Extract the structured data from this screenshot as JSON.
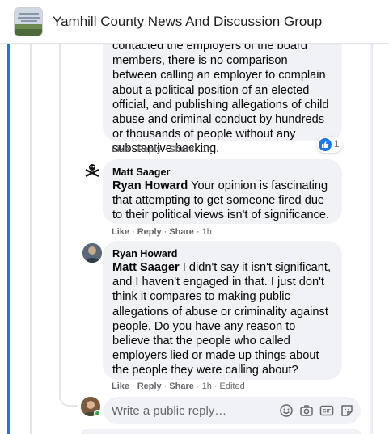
{
  "header": {
    "group_name": "Yamhill County News And Discussion Group"
  },
  "comments": [
    {
      "text": "contacted the employers of the board members, there is no comparison between calling an employer to complain about a political position of an elected official, and publishing allegations of child abuse and criminal conduct by hundreds or thousands of people without any substantive backing.",
      "actions": {
        "like": "Like",
        "reply": "Reply",
        "share": "Share",
        "time": "1h"
      },
      "reaction_count": "1",
      "reaction_icon": "like-icon"
    },
    {
      "author": "Matt Saager",
      "mention": "Ryan Howard",
      "text": " Your opinion is fascinating that attempting to get someone fired due to their political views isn't of significance.",
      "actions": {
        "like": "Like",
        "reply": "Reply",
        "share": "Share",
        "time": "1h"
      }
    },
    {
      "author": "Ryan Howard",
      "mention": "Matt Saager",
      "text": " I didn't say it isn't significant, and I haven't engaged in that. I just don't think it compares to making public allegations of abuse or criminality against people. Do you have any reason to believe that the people who called employers lied or made up things about the people they were calling about?",
      "actions": {
        "like": "Like",
        "reply": "Reply",
        "share": "Share",
        "time": "1h",
        "edited": "Edited"
      }
    }
  ],
  "reply_box": {
    "placeholder": "Write a public reply…",
    "icons": [
      "emoji-icon",
      "camera-icon",
      "gif-icon",
      "sticker-icon"
    ]
  },
  "colors": {
    "accent": "#1877f2",
    "bubble": "#f0f2f5",
    "secondary_text": "#65676b",
    "online": "#31a24c"
  }
}
